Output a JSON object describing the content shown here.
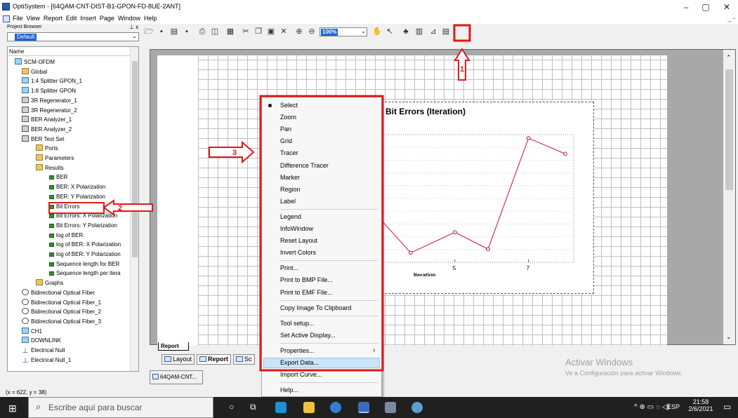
{
  "window": {
    "title": "OptiSystem - [64QAM-CNT-DIST-B1-GPON-FD-8UE-2ANT]",
    "controls": [
      "–",
      "▢",
      "✕"
    ]
  },
  "menubar": {
    "items": [
      "File",
      "View",
      "Report",
      "Edit",
      "Insert",
      "Page",
      "Window",
      "Help"
    ],
    "mdi_controls": "_ ▫"
  },
  "project_browser": {
    "label": "Project Browser",
    "close": "⊥ x",
    "layer": "Default",
    "column_header": "Name"
  },
  "tree": [
    {
      "label": "SCM-OFDM",
      "icon": "comp"
    },
    {
      "label": "Global",
      "icon": "folder"
    },
    {
      "label": "1:4 Splitter GPON_1",
      "icon": "comp"
    },
    {
      "label": "1:8 Splitter GPON",
      "icon": "comp"
    },
    {
      "label": "3R Regenerator_1",
      "icon": "dev"
    },
    {
      "label": "3R Regenerator_2",
      "icon": "dev"
    },
    {
      "label": "BER Analyzer_1",
      "icon": "dev"
    },
    {
      "label": "BER Analyzer_2",
      "icon": "dev"
    },
    {
      "label": "BER Test Set",
      "icon": "dev"
    },
    {
      "label": "Ports",
      "icon": "folder"
    },
    {
      "label": "Parameters",
      "icon": "folder"
    },
    {
      "label": "Results",
      "icon": "folder"
    },
    {
      "label": "BER",
      "icon": "res"
    },
    {
      "label": "BER: X Polarization",
      "icon": "res"
    },
    {
      "label": "BER: Y Polarization",
      "icon": "res"
    },
    {
      "label": "Bit Errors",
      "icon": "res"
    },
    {
      "label": "Bit Errors: X Polarization",
      "icon": "res"
    },
    {
      "label": "Bit Errors: Y Polarization",
      "icon": "res"
    },
    {
      "label": "log of BER",
      "icon": "res"
    },
    {
      "label": "log of BER: X Polarization",
      "icon": "res"
    },
    {
      "label": "log of BER: Y Polarization",
      "icon": "res"
    },
    {
      "label": "Sequence length for BER",
      "icon": "res"
    },
    {
      "label": "Sequence length per itera",
      "icon": "res"
    },
    {
      "label": "Graphs",
      "icon": "folder"
    },
    {
      "label": "Bidirectional Optical Fiber",
      "icon": "fiber"
    },
    {
      "label": "Bidirectional Optical Fiber_1",
      "icon": "fiber"
    },
    {
      "label": "Bidirectional Optical Fiber_2",
      "icon": "fiber"
    },
    {
      "label": "Bidirectional Optical Fiber_3",
      "icon": "fiber"
    },
    {
      "label": "CH1",
      "icon": "comp"
    },
    {
      "label": "DOWNLINK",
      "icon": "comp"
    },
    {
      "label": "Electrical Null",
      "icon": "null"
    },
    {
      "label": "Electrical Null_1",
      "icon": "null"
    }
  ],
  "toolbar": {
    "zoom": "100%"
  },
  "status_bar": "(x = 622, y = 38)",
  "chart": {
    "title": "Bit Errors (Iteration)",
    "xlabel": "Iteration",
    "tick_labels": [
      "5",
      "7"
    ]
  },
  "chart_data": {
    "type": "line",
    "title": "Bit Errors (Iteration)",
    "xlabel": "Iteration",
    "ylabel": "",
    "x_ticks": [
      5,
      7
    ],
    "series": [
      {
        "x": [
          3,
          3.8,
          5,
          5.9,
          7,
          8
        ],
        "values": [
          0.32,
          0.05,
          0.22,
          0.08,
          1.0,
          0.87
        ]
      }
    ],
    "grid": true,
    "line_color": "#c8102e"
  },
  "context_menu": {
    "groups": [
      [
        "Select",
        "Zoom",
        "Pan",
        "Grid",
        "Tracer",
        "Difference Tracer",
        "Marker",
        "Region",
        "Label"
      ],
      [
        "Legend",
        "InfoWindow",
        "Reset Layout",
        "Invert Colors"
      ],
      [
        "Print...",
        "Print to BMP File...",
        "Print to EMF File..."
      ],
      [
        "Copy Image To Clipboard"
      ],
      [
        "Tool setup...",
        "Set Active Display..."
      ],
      [
        "Properties...",
        "Export Data...",
        "Import Curve..."
      ],
      [
        "Help..."
      ]
    ],
    "checked": "Select",
    "highlighted": "Export Data...",
    "submenu_arrow": "›"
  },
  "tabs": {
    "report_tab": "Report",
    "view_tabs": [
      "Layout",
      "Report",
      "Sc"
    ],
    "doc_tab": "64QAM-CNT..."
  },
  "annotations": {
    "labels": [
      "1",
      "2",
      "3"
    ],
    "color": "#e01818"
  },
  "watermark": {
    "title": "Activar Windows",
    "subtitle": "Ve a Configuración para activar Windows."
  },
  "taskbar": {
    "search_placeholder": "Escribe aquí para buscar",
    "tray_lang": "ESP",
    "time": "21:58",
    "date": "2/6/2021"
  }
}
